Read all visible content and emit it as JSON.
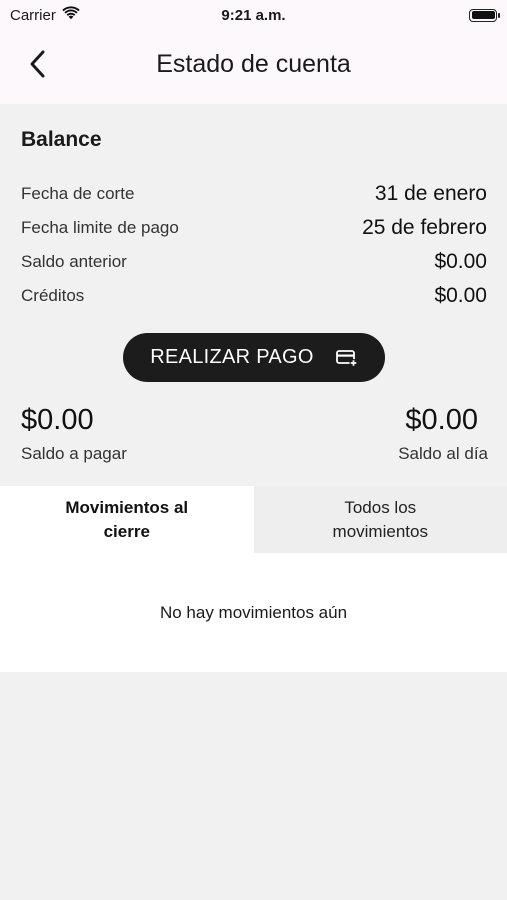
{
  "status_bar": {
    "carrier": "Carrier",
    "time": "9:21 a.m."
  },
  "header": {
    "title": "Estado de cuenta",
    "back_icon": "chevron-left-icon"
  },
  "balance": {
    "heading": "Balance",
    "rows": [
      {
        "label": "Fecha de corte",
        "value": "31 de enero"
      },
      {
        "label": "Fecha limite de pago",
        "value": "25 de febrero"
      },
      {
        "label": "Saldo anterior",
        "value": "$0.00"
      },
      {
        "label": "Créditos",
        "value": "$0.00"
      }
    ],
    "pay_button": {
      "label": "REALIZAR PAGO",
      "icon": "credit-card-plus-icon"
    },
    "amount_to_pay": {
      "value": "$0.00",
      "label": "Saldo a pagar"
    },
    "amount_current": {
      "value": "$0.00",
      "label": "Saldo al día"
    }
  },
  "tabs": [
    {
      "label": "Movimientos al cierre",
      "active": true
    },
    {
      "label": "Todos los movimientos",
      "active": false
    }
  ],
  "content": {
    "empty_message": "No hay movimientos aún"
  },
  "colors": {
    "header_bg": "#fdf8fb",
    "page_bg": "#f1f1f1",
    "button_bg": "#1c1c1c"
  }
}
